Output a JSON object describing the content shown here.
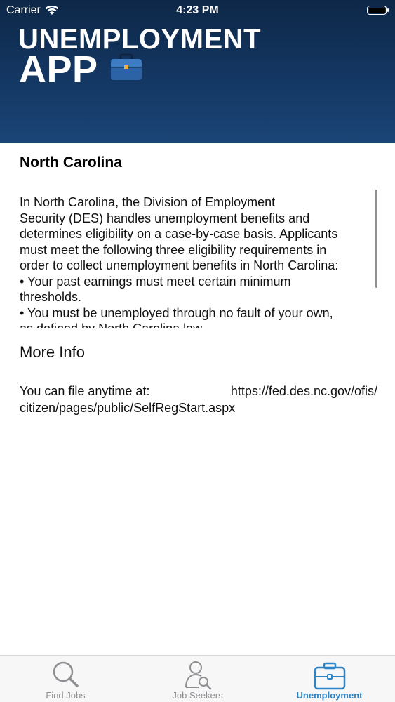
{
  "status_bar": {
    "carrier": "Carrier",
    "time": "4:23 PM"
  },
  "header": {
    "title_line1": "UNEMPLOYMENT",
    "title_line2": "APP",
    "logo_icon": "briefcase-icon"
  },
  "state": {
    "title": "North Carolina",
    "description": "In North Carolina, the Division of Employment\nSecurity (DES) handles unemployment benefits and\ndetermines eligibility on a case-by-case basis. Applicants\nmust meet the following three eligibility requirements in\norder to collect unemployment benefits in North Carolina:\n• Your past earnings must meet certain minimum\nthresholds.\n• You must be unemployed through no fault of your own,\nas defined by North Carolina law."
  },
  "more_info": {
    "title": "More Info",
    "file_label": "You can file anytime at:",
    "link_line1": "https://fed.des.nc.gov/ofis/",
    "link_line2": "citizen/pages/public/SelfRegStart.aspx"
  },
  "tab_bar": {
    "tabs": [
      {
        "label": "Find Jobs",
        "icon": "magnifier-icon",
        "active": false
      },
      {
        "label": "Job Seekers",
        "icon": "person-search-icon",
        "active": false
      },
      {
        "label": "Unemployment",
        "icon": "briefcase-icon",
        "active": true
      }
    ]
  },
  "colors": {
    "header_dark": "#0d2747",
    "header_light": "#1a4576",
    "active_tab": "#2f84c6",
    "inactive_tab": "#8e8e93"
  }
}
